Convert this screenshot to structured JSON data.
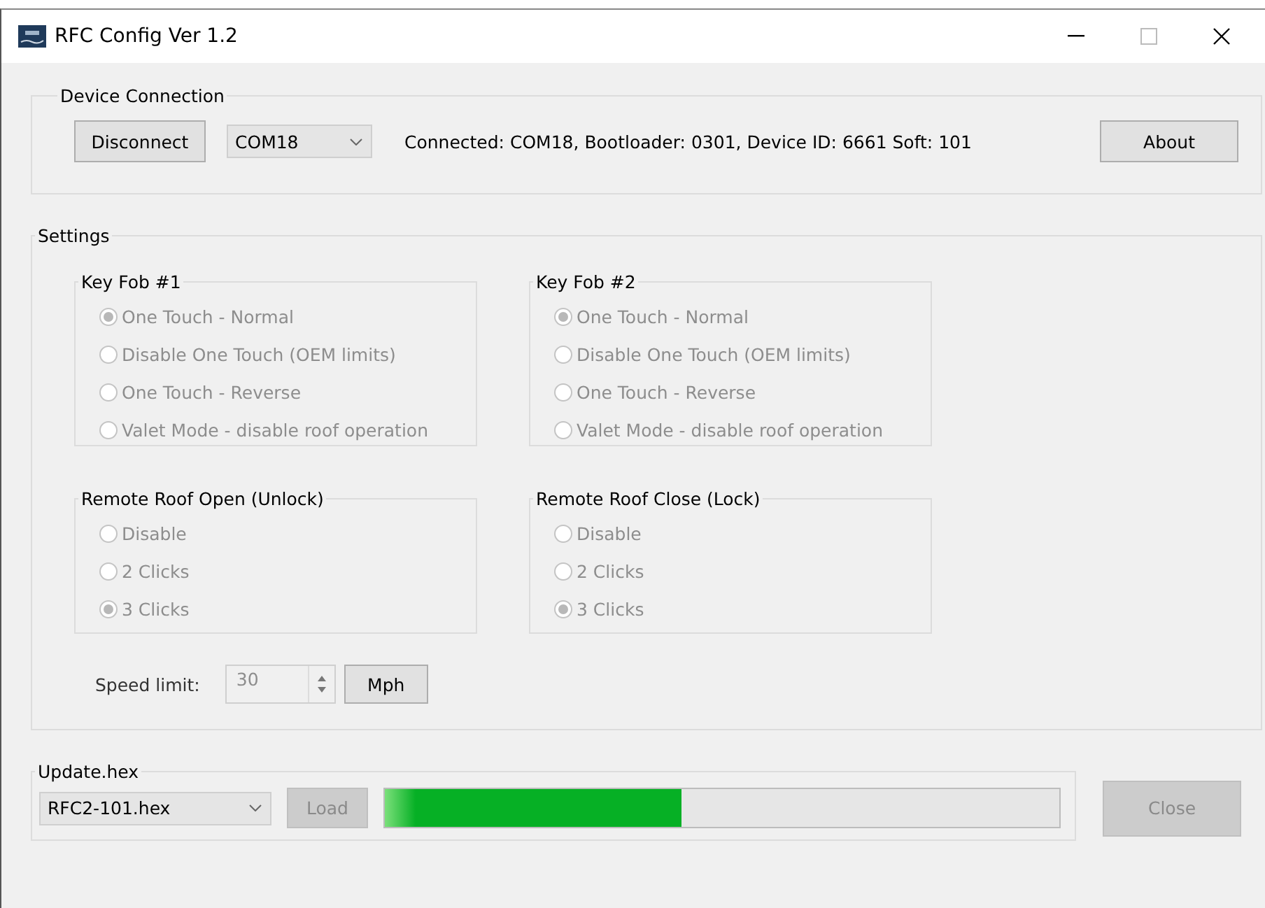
{
  "window": {
    "title": "RFC Config Ver 1.2"
  },
  "device_connection": {
    "title": "Device Connection",
    "disconnect_button": "Disconnect",
    "port": "COM18",
    "status": "Connected: COM18, Bootloader: 0301, Device ID: 6661 Soft: 101",
    "about_button": "About"
  },
  "settings": {
    "title": "Settings",
    "disabled": true,
    "groups": [
      {
        "title": "Key Fob #1",
        "options": [
          {
            "label": "One Touch - Normal",
            "selected": true
          },
          {
            "label": "Disable One Touch (OEM limits)",
            "selected": false
          },
          {
            "label": "One Touch - Reverse",
            "selected": false
          },
          {
            "label": "Valet Mode - disable roof operation",
            "selected": false
          }
        ]
      },
      {
        "title": "Key Fob #2",
        "options": [
          {
            "label": "One Touch - Normal",
            "selected": true
          },
          {
            "label": "Disable One Touch (OEM limits)",
            "selected": false
          },
          {
            "label": "One Touch - Reverse",
            "selected": false
          },
          {
            "label": "Valet Mode - disable roof operation",
            "selected": false
          }
        ]
      },
      {
        "title": "Remote Roof Open (Unlock)",
        "options": [
          {
            "label": "Disable",
            "selected": false
          },
          {
            "label": "2 Clicks",
            "selected": false
          },
          {
            "label": "3 Clicks",
            "selected": true
          }
        ]
      },
      {
        "title": "Remote Roof Close (Lock)",
        "options": [
          {
            "label": "Disable",
            "selected": false
          },
          {
            "label": "2 Clicks",
            "selected": false
          },
          {
            "label": "3 Clicks",
            "selected": true
          }
        ]
      }
    ],
    "speed_limit": {
      "label": "Speed limit:",
      "value": "30",
      "unit_button": "Mph"
    }
  },
  "update": {
    "title": "Update.hex",
    "file": "RFC2-101.hex",
    "load_button": "Load",
    "load_disabled": true,
    "level": 0.44
  },
  "close_button": {
    "label": "Close",
    "disabled": true
  }
}
